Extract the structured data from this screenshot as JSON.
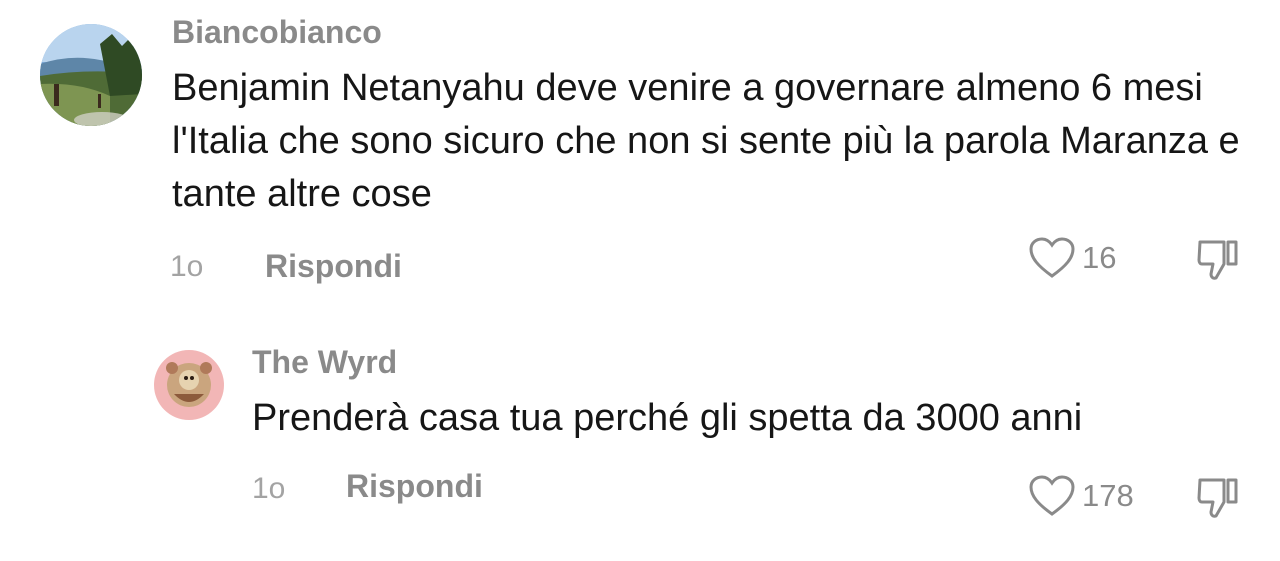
{
  "comments": [
    {
      "username": "Biancobianco",
      "text": "Benjamin Netanyahu deve venire a governare almeno 6 mesi l'Italia che sono sicuro che non si sente più la parola Maranza e tante altre cose",
      "time": "1o",
      "reply_label": "Rispondi",
      "likes": "16",
      "like_icon": "heart-outline",
      "dislike_icon": "thumbs-down-outline"
    },
    {
      "username": "The Wyrd",
      "text": "Prenderà casa tua perché gli spetta da 3000 anni",
      "time": "1o",
      "reply_label": "Rispondi",
      "likes": "178",
      "like_icon": "heart-outline",
      "dislike_icon": "thumbs-down-outline"
    }
  ],
  "colors": {
    "text": "#161616",
    "muted": "#8a8a8a",
    "background": "#ffffff"
  }
}
